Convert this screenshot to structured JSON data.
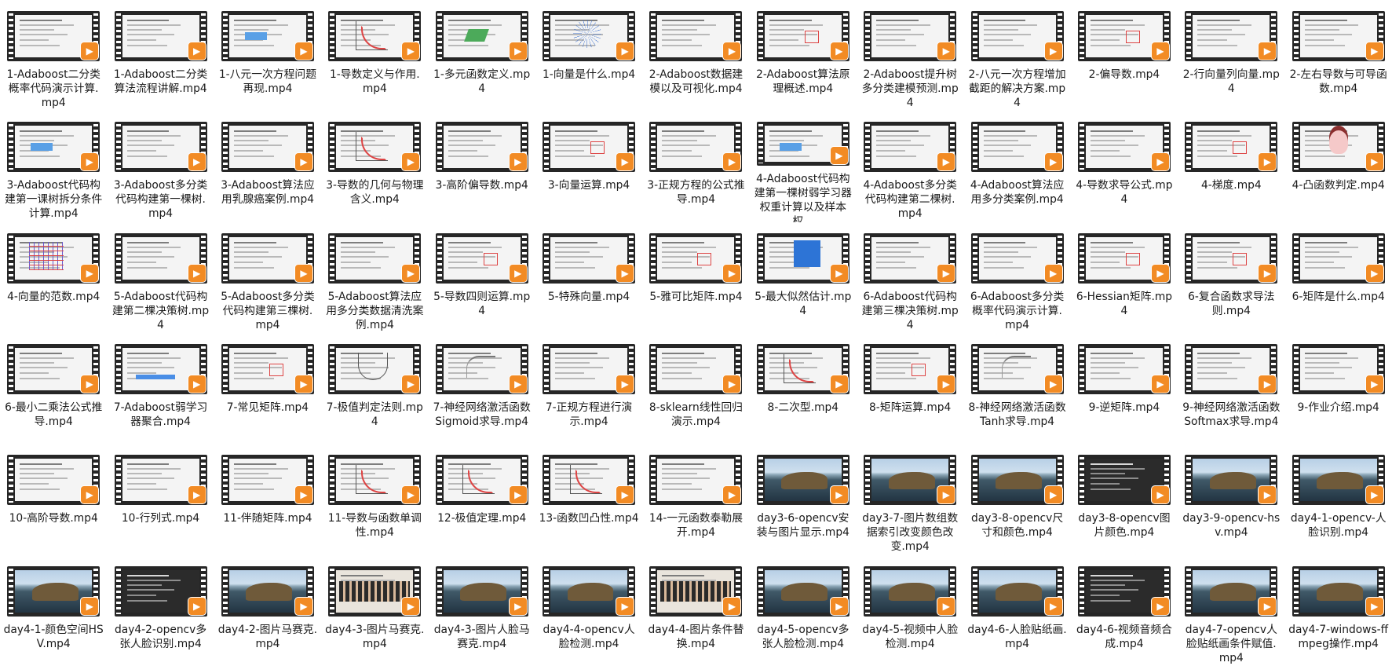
{
  "files": [
    {
      "label": "1-Adaboost二分类概率代码演示计算.mp4",
      "thumb": "doc"
    },
    {
      "label": "1-Adaboost二分类算法流程讲解.mp4",
      "thumb": "doc"
    },
    {
      "label": "1-八元一次方程问题再现.mp4",
      "thumb": "blue"
    },
    {
      "label": "1-导数定义与作用.mp4",
      "thumb": "graph"
    },
    {
      "label": "1-多元函数定义.mp4",
      "thumb": "green"
    },
    {
      "label": "1-向量是什么.mp4",
      "thumb": "star"
    },
    {
      "label": "2-Adaboost数据建模以及可视化.mp4",
      "thumb": "doc"
    },
    {
      "label": "2-Adaboost算法原理概述.mp4",
      "thumb": "red"
    },
    {
      "label": "2-Adaboost提升树多分类建模预测.mp4",
      "thumb": "doc"
    },
    {
      "label": "2-八元一次方程增加截距的解决方案.mp4",
      "thumb": "doc"
    },
    {
      "label": "2-偏导数.mp4",
      "thumb": "red"
    },
    {
      "label": "2-行向量列向量.mp4",
      "thumb": "doc"
    },
    {
      "label": "2-左右导数与可导函数.mp4",
      "thumb": "doc"
    },
    {
      "label": "3-Adaboost代码构建第一课树拆分条件计算.mp4",
      "thumb": "blue"
    },
    {
      "label": "3-Adaboost多分类代码构建第一棵树.mp4",
      "thumb": "doc"
    },
    {
      "label": "3-Adaboost算法应用乳腺癌案例.mp4",
      "thumb": "doc"
    },
    {
      "label": "3-导数的几何与物理含义.mp4",
      "thumb": "graph"
    },
    {
      "label": "3-高阶偏导数.mp4",
      "thumb": "doc"
    },
    {
      "label": "3-向量运算.mp4",
      "thumb": "red"
    },
    {
      "label": "3-正规方程的公式推导.mp4",
      "thumb": "doc"
    },
    {
      "label": "4-Adaboost代码构建第一棵树弱学习器权重计算以及样本权...",
      "thumb": "blue"
    },
    {
      "label": "4-Adaboost多分类代码构建第二棵树.mp4",
      "thumb": "doc"
    },
    {
      "label": "4-Adaboost算法应用多分类案例.mp4",
      "thumb": "doc"
    },
    {
      "label": "4-导数求导公式.mp4",
      "thumb": "doc"
    },
    {
      "label": "4-梯度.mp4",
      "thumb": "red"
    },
    {
      "label": "4-凸函数判定.mp4",
      "thumb": "face"
    },
    {
      "label": "4-向量的范数.mp4",
      "thumb": "grid"
    },
    {
      "label": "5-Adaboost代码构建第二棵决策树.mp4",
      "thumb": "doc"
    },
    {
      "label": "5-Adaboost多分类代码构建第三棵树.mp4",
      "thumb": "doc"
    },
    {
      "label": "5-Adaboost算法应用多分类数据清洗案例.mp4",
      "thumb": "doc"
    },
    {
      "label": "5-导数四则运算.mp4",
      "thumb": "red"
    },
    {
      "label": "5-特殊向量.mp4",
      "thumb": "doc"
    },
    {
      "label": "5-雅可比矩阵.mp4",
      "thumb": "red"
    },
    {
      "label": "5-最大似然估计.mp4",
      "thumb": "heart"
    },
    {
      "label": "6-Adaboost代码构建第三棵决策树.mp4",
      "thumb": "doc"
    },
    {
      "label": "6-Adaboost多分类概率代码演示计算.mp4",
      "thumb": "doc"
    },
    {
      "label": "6-Hessian矩阵.mp4",
      "thumb": "red"
    },
    {
      "label": "6-复合函数求导法则.mp4",
      "thumb": "red"
    },
    {
      "label": "6-矩阵是什么.mp4",
      "thumb": "doc"
    },
    {
      "label": "6-最小二乘法公式推导.mp4",
      "thumb": "doc"
    },
    {
      "label": "7-Adaboost弱学习器聚合.mp4",
      "thumb": "bars"
    },
    {
      "label": "7-常见矩阵.mp4",
      "thumb": "red"
    },
    {
      "label": "7-极值判定法则.mp4",
      "thumb": "parab"
    },
    {
      "label": "7-神经网络激活函数Sigmoid求导.mp4",
      "thumb": "sig"
    },
    {
      "label": "7-正规方程进行演示.mp4",
      "thumb": "doc"
    },
    {
      "label": "8-sklearn线性回归演示.mp4",
      "thumb": "doc"
    },
    {
      "label": "8-二次型.mp4",
      "thumb": "graph"
    },
    {
      "label": "8-矩阵运算.mp4",
      "thumb": "red"
    },
    {
      "label": "8-神经网络激活函数Tanh求导.mp4",
      "thumb": "sig"
    },
    {
      "label": "9-逆矩阵.mp4",
      "thumb": "doc"
    },
    {
      "label": "9-神经网络激活函数Softmax求导.mp4",
      "thumb": "doc"
    },
    {
      "label": "9-作业介绍.mp4",
      "thumb": "doc"
    },
    {
      "label": "10-高阶导数.mp4",
      "thumb": "doc"
    },
    {
      "label": "10-行列式.mp4",
      "thumb": "doc"
    },
    {
      "label": "11-伴随矩阵.mp4",
      "thumb": "doc"
    },
    {
      "label": "11-导数与函数单调性.mp4",
      "thumb": "graph"
    },
    {
      "label": "12-极值定理.mp4",
      "thumb": "graph"
    },
    {
      "label": "13-函数凹凸性.mp4",
      "thumb": "graph"
    },
    {
      "label": "14-一元函数泰勒展开.mp4",
      "thumb": "doc"
    },
    {
      "label": "day3-6-opencv安装与图片显示.mp4",
      "thumb": "mac"
    },
    {
      "label": "day3-7-图片数组数据索引改变颜色改变.mp4",
      "thumb": "mac"
    },
    {
      "label": "day3-8-opencv尺寸和颜色.mp4",
      "thumb": "mac"
    },
    {
      "label": "day3-8-opencv图片颜色.mp4",
      "thumb": "dark"
    },
    {
      "label": "day3-9-opencv-hsv.mp4",
      "thumb": "mac"
    },
    {
      "label": "day4-1-opencv-人脸识别.mp4",
      "thumb": "mac"
    },
    {
      "label": "day4-1-颜色空间HSV.mp4",
      "thumb": "mac"
    },
    {
      "label": "day4-2-opencv多张人脸识别.mp4",
      "thumb": "dark"
    },
    {
      "label": "day4-2-图片马赛克.mp4",
      "thumb": "mac"
    },
    {
      "label": "day4-3-图片马赛克.mp4",
      "thumb": "people"
    },
    {
      "label": "day4-3-图片人脸马赛克.mp4",
      "thumb": "mac"
    },
    {
      "label": "day4-4-opencv人脸检测.mp4",
      "thumb": "mac"
    },
    {
      "label": "day4-4-图片条件替换.mp4",
      "thumb": "people"
    },
    {
      "label": "day4-5-opencv多张人脸检测.mp4",
      "thumb": "mac"
    },
    {
      "label": "day4-5-视频中人脸检测.mp4",
      "thumb": "mac"
    },
    {
      "label": "day4-6-人脸贴纸画.mp4",
      "thumb": "mac"
    },
    {
      "label": "day4-6-视频音频合成.mp4",
      "thumb": "dark"
    },
    {
      "label": "day4-7-opencv人脸贴纸画条件赋值.mp4",
      "thumb": "mac"
    },
    {
      "label": "day4-7-windows-ffmpeg操作.mp4",
      "thumb": "mac"
    }
  ],
  "icons": {
    "play_badge": "play-icon",
    "play_color": "#f28b24",
    "film_color": "#262626"
  }
}
